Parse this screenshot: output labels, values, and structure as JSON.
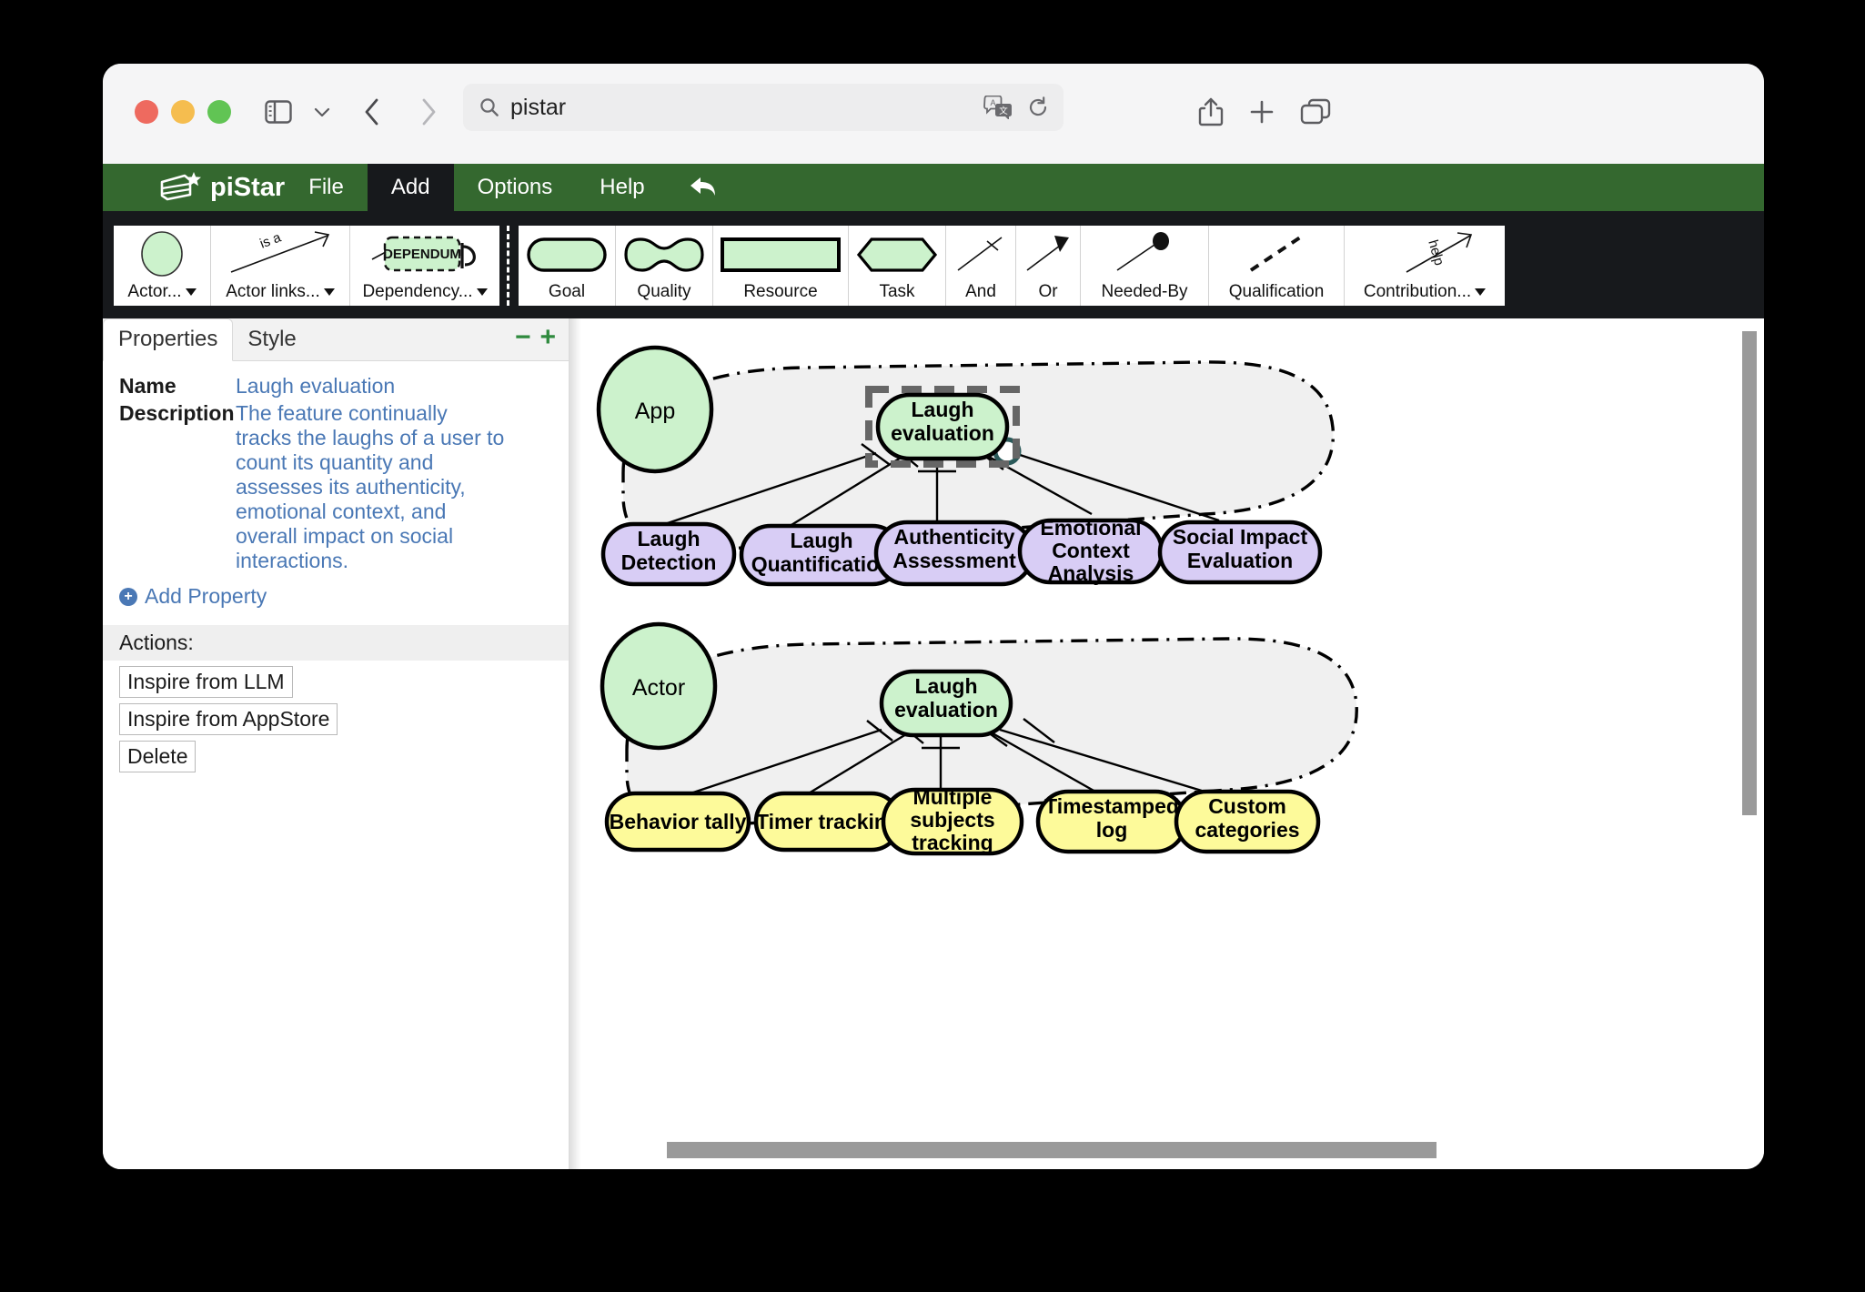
{
  "browser": {
    "url_text": "pistar",
    "icons": {
      "sidebar": "sidebar-icon",
      "sidebar_chevron": "chevron-down-icon",
      "back": "back-chevron-icon",
      "forward": "forward-chevron-icon",
      "reader": "reader-view-icon",
      "search": "search-icon",
      "translate": "translate-icon",
      "reload": "reload-icon",
      "share": "share-icon",
      "new_tab": "plus-icon",
      "tab_overview": "tab-overview-icon"
    }
  },
  "menubar": {
    "brand": "piStar",
    "items": [
      {
        "label": "File",
        "active": false
      },
      {
        "label": "Add",
        "active": true
      },
      {
        "label": "Options",
        "active": false
      },
      {
        "label": "Help",
        "active": false
      }
    ],
    "undo_label": "undo-arrow-icon"
  },
  "palette": {
    "group_left": [
      {
        "label": "Actor...",
        "icon": "actor-circle-icon",
        "dropdown": true
      },
      {
        "label": "Actor links...",
        "icon": "is-a-link-icon",
        "dropdown": true,
        "glyph_text": "is a"
      },
      {
        "label": "Dependency...",
        "icon": "dependum-icon",
        "dropdown": true,
        "glyph_text": "DEPENDUM"
      }
    ],
    "group_right": [
      {
        "label": "Goal",
        "icon": "goal-shape-icon",
        "dropdown": false
      },
      {
        "label": "Quality",
        "icon": "quality-shape-icon",
        "dropdown": false
      },
      {
        "label": "Resource",
        "icon": "resource-shape-icon",
        "dropdown": false
      },
      {
        "label": "Task",
        "icon": "task-shape-icon",
        "dropdown": false
      },
      {
        "label": "And",
        "icon": "and-link-icon",
        "dropdown": false
      },
      {
        "label": "Or",
        "icon": "or-link-icon",
        "dropdown": false
      },
      {
        "label": "Needed-By",
        "icon": "needed-by-link-icon",
        "dropdown": false
      },
      {
        "label": "Qualification",
        "icon": "qualification-link-icon",
        "dropdown": false
      },
      {
        "label": "Contribution...",
        "icon": "contribution-link-icon",
        "dropdown": true,
        "glyph_text": "help"
      }
    ]
  },
  "panel": {
    "tabs": [
      {
        "label": "Properties",
        "active": true
      },
      {
        "label": "Style",
        "active": false
      }
    ],
    "zoom_out": "−",
    "zoom_in": "+",
    "fields": [
      {
        "label": "Name",
        "value": "Laugh evaluation"
      },
      {
        "label": "Description",
        "value": "The feature continually tracks the laughs of a user to count its quantity and assesses its authenticity, emotional context, and overall impact on social interactions."
      }
    ],
    "add_property": "Add Property",
    "actions_header": "Actions:",
    "actions": [
      "Inspire from LLM",
      "Inspire from AppStore",
      "Delete"
    ]
  },
  "colors": {
    "brand_green": "#34682f",
    "palette_dark": "#17191c",
    "actor_fill": "#ccf2cc",
    "goal_fill": "#ccf2cc",
    "task_purple": "#d8cdf5",
    "task_yellow": "#fdfa9a",
    "boundary_fill": "#f0f0f0",
    "link_blue": "#4a78b5",
    "selection_grey": "#666666",
    "scrollbar": "#9a9a9a"
  },
  "diagram": {
    "actors": [
      {
        "name": "App",
        "root_goal": "Laugh evaluation",
        "root_goal_selected": true,
        "child_fill": "task_purple",
        "children": [
          "Laugh Detection",
          "Laugh Quantification",
          "Authenticity Assessment",
          "Emotional Context Analysis",
          "Social Impact Evaluation"
        ]
      },
      {
        "name": "Actor",
        "root_goal": "Laugh evaluation",
        "root_goal_selected": false,
        "child_fill": "task_yellow",
        "children": [
          "Behavior tally",
          "Timer tracking",
          "Multiple subjects tracking",
          "Timestamped log",
          "Custom categories"
        ]
      }
    ]
  }
}
